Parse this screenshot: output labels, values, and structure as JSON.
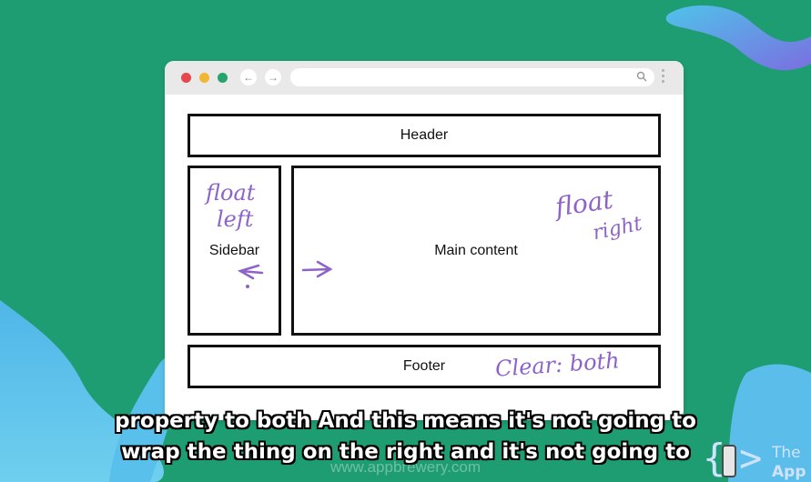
{
  "diagram": {
    "header": "Header",
    "sidebar": "Sidebar",
    "main": "Main content",
    "footer": "Footer"
  },
  "annotations": {
    "float_left_1": "float",
    "float_left_2": "left",
    "float_right_1": "float",
    "float_right_2": "right",
    "clear_both": "Clear: both"
  },
  "subtitles": {
    "line1": "property to both And this means it's not going to",
    "line2": "wrap the thing on the right and it's not going to"
  },
  "watermark": "www.appbrewery.com",
  "brand": {
    "line1": "The",
    "line2": "App"
  },
  "colors": {
    "background": "#1f9d72",
    "annotation": "#8d63c9",
    "blob_blue": "#4fb6e8",
    "blob_purple": "#7b7fe6"
  }
}
